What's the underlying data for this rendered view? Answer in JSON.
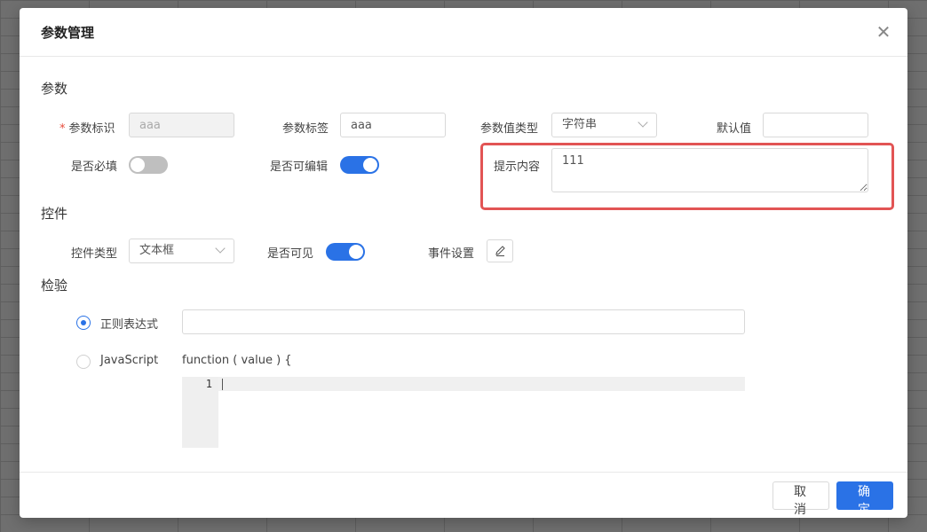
{
  "dialog": {
    "title": "参数管理",
    "close_glyph": "✕"
  },
  "params": {
    "section_title": "参数",
    "param_id": {
      "label": "参数标识",
      "required_mark": "*",
      "value": "aaa"
    },
    "param_label": {
      "label": "参数标签",
      "value": "aaa"
    },
    "value_type": {
      "label": "参数值类型",
      "value": "字符串"
    },
    "default_value": {
      "label": "默认值",
      "value": ""
    },
    "required": {
      "label": "是否必填",
      "on": false
    },
    "editable": {
      "label": "是否可编辑",
      "on": true
    },
    "hint": {
      "label": "提示内容",
      "value": "111"
    }
  },
  "control": {
    "section_title": "控件",
    "control_type": {
      "label": "控件类型",
      "value": "文本框"
    },
    "visible": {
      "label": "是否可见",
      "on": true
    },
    "event_settings": {
      "label": "事件设置",
      "icon": "edit-icon"
    }
  },
  "validation": {
    "section_title": "检验",
    "regex": {
      "label": "正则表达式",
      "checked": true,
      "value": ""
    },
    "javascript": {
      "label": "JavaScript",
      "checked": false,
      "signature": "function ( value ) {",
      "line_number": "1"
    }
  },
  "footer": {
    "cancel_label": "取 消",
    "ok_label": "确 定"
  },
  "colors": {
    "accent": "#2a72e6",
    "highlight": "#e25454"
  }
}
